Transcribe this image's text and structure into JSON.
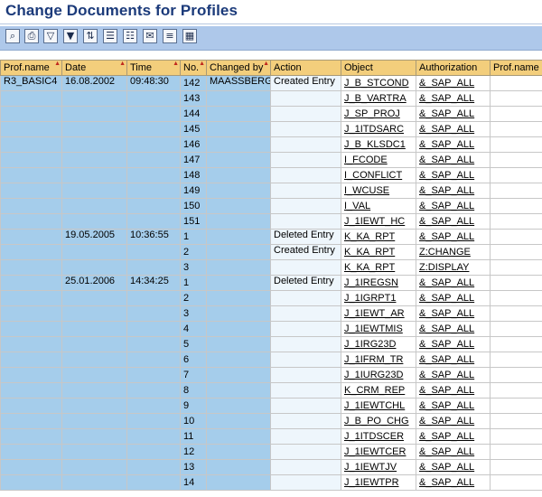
{
  "title": "Change Documents for Profiles",
  "toolbar": {
    "buttons": [
      "zoom-details",
      "print",
      "filter",
      "set-filter",
      "display-sort",
      "export-local-file",
      "spreadsheet",
      "mail",
      "column-set",
      "layout-grid"
    ]
  },
  "columns": {
    "prof_name": "Prof.name",
    "date": "Date",
    "time": "Time",
    "no": "No.",
    "changed_by": "Changed by",
    "action": "Action",
    "object": "Object",
    "authorization": "Authorization",
    "prof_name2": "Prof.name"
  },
  "rows": [
    {
      "prof": "R3_BASIC4",
      "date": "16.08.2002",
      "time": "09:48:30",
      "no": "142",
      "by": "MAASSBERG",
      "action": "Created Entry",
      "object": "J_B_STCOND",
      "auth": "&_SAP_ALL"
    },
    {
      "prof": "",
      "date": "",
      "time": "",
      "no": "143",
      "by": "",
      "action": "",
      "object": "J_B_VARTRA",
      "auth": "&_SAP_ALL"
    },
    {
      "prof": "",
      "date": "",
      "time": "",
      "no": "144",
      "by": "",
      "action": "",
      "object": "J_SP_PROJ",
      "auth": "&_SAP_ALL"
    },
    {
      "prof": "",
      "date": "",
      "time": "",
      "no": "145",
      "by": "",
      "action": "",
      "object": "J_1ITDSARC",
      "auth": "&_SAP_ALL"
    },
    {
      "prof": "",
      "date": "",
      "time": "",
      "no": "146",
      "by": "",
      "action": "",
      "object": "J_B_KLSDC1",
      "auth": "&_SAP_ALL"
    },
    {
      "prof": "",
      "date": "",
      "time": "",
      "no": "147",
      "by": "",
      "action": "",
      "object": "I_FCODE",
      "auth": "&_SAP_ALL"
    },
    {
      "prof": "",
      "date": "",
      "time": "",
      "no": "148",
      "by": "",
      "action": "",
      "object": "I_CONFLICT",
      "auth": "&_SAP_ALL"
    },
    {
      "prof": "",
      "date": "",
      "time": "",
      "no": "149",
      "by": "",
      "action": "",
      "object": "I_WCUSE",
      "auth": "&_SAP_ALL"
    },
    {
      "prof": "",
      "date": "",
      "time": "",
      "no": "150",
      "by": "",
      "action": "",
      "object": "I_VAL",
      "auth": "&_SAP_ALL"
    },
    {
      "prof": "",
      "date": "",
      "time": "",
      "no": "151",
      "by": "",
      "action": "",
      "object": "J_1IEWT_HC",
      "auth": "&_SAP_ALL"
    },
    {
      "prof": "",
      "date": "19.05.2005",
      "time": "10:36:55",
      "no": "1",
      "by": "",
      "action": "Deleted Entry",
      "object": "K_KA_RPT",
      "auth": "&_SAP_ALL"
    },
    {
      "prof": "",
      "date": "",
      "time": "",
      "no": "2",
      "by": "",
      "action": "Created Entry",
      "object": "K_KA_RPT",
      "auth": "Z:CHANGE"
    },
    {
      "prof": "",
      "date": "",
      "time": "",
      "no": "3",
      "by": "",
      "action": "",
      "object": "K_KA_RPT",
      "auth": "Z:DISPLAY"
    },
    {
      "prof": "",
      "date": "25.01.2006",
      "time": "14:34:25",
      "no": "1",
      "by": "",
      "action": "Deleted Entry",
      "object": "J_1IREGSN",
      "auth": "&_SAP_ALL"
    },
    {
      "prof": "",
      "date": "",
      "time": "",
      "no": "2",
      "by": "",
      "action": "",
      "object": "J_1IGRPT1",
      "auth": "&_SAP_ALL"
    },
    {
      "prof": "",
      "date": "",
      "time": "",
      "no": "3",
      "by": "",
      "action": "",
      "object": "J_1IEWT_AR",
      "auth": "&_SAP_ALL"
    },
    {
      "prof": "",
      "date": "",
      "time": "",
      "no": "4",
      "by": "",
      "action": "",
      "object": "J_1IEWTMIS",
      "auth": "&_SAP_ALL"
    },
    {
      "prof": "",
      "date": "",
      "time": "",
      "no": "5",
      "by": "",
      "action": "",
      "object": "J_1IRG23D",
      "auth": "&_SAP_ALL"
    },
    {
      "prof": "",
      "date": "",
      "time": "",
      "no": "6",
      "by": "",
      "action": "",
      "object": "J_1IFRM_TR",
      "auth": "&_SAP_ALL"
    },
    {
      "prof": "",
      "date": "",
      "time": "",
      "no": "7",
      "by": "",
      "action": "",
      "object": "J_1IURG23D",
      "auth": "&_SAP_ALL"
    },
    {
      "prof": "",
      "date": "",
      "time": "",
      "no": "8",
      "by": "",
      "action": "",
      "object": "K_CRM_REP",
      "auth": "&_SAP_ALL"
    },
    {
      "prof": "",
      "date": "",
      "time": "",
      "no": "9",
      "by": "",
      "action": "",
      "object": "J_1IEWTCHL",
      "auth": "&_SAP_ALL"
    },
    {
      "prof": "",
      "date": "",
      "time": "",
      "no": "10",
      "by": "",
      "action": "",
      "object": "J_B_PO_CHG",
      "auth": "&_SAP_ALL"
    },
    {
      "prof": "",
      "date": "",
      "time": "",
      "no": "11",
      "by": "",
      "action": "",
      "object": "J_1ITDSCER",
      "auth": "&_SAP_ALL"
    },
    {
      "prof": "",
      "date": "",
      "time": "",
      "no": "12",
      "by": "",
      "action": "",
      "object": "J_1IEWTCER",
      "auth": "&_SAP_ALL"
    },
    {
      "prof": "",
      "date": "",
      "time": "",
      "no": "13",
      "by": "",
      "action": "",
      "object": "J_1IEWTJV",
      "auth": "&_SAP_ALL"
    },
    {
      "prof": "",
      "date": "",
      "time": "",
      "no": "14",
      "by": "",
      "action": "",
      "object": "J_1IEWTPR",
      "auth": "&_SAP_ALL"
    }
  ]
}
